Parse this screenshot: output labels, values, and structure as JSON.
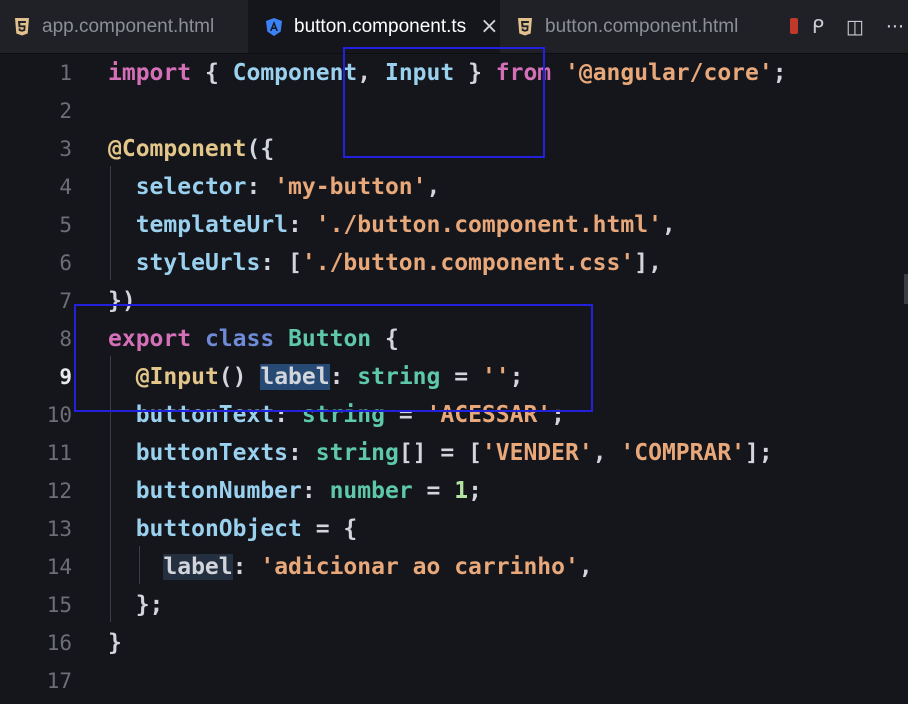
{
  "tabs": [
    {
      "label": "app.component.html",
      "icon": "html5-icon",
      "active": false
    },
    {
      "label": "button.component.ts",
      "icon": "angular-icon",
      "active": true,
      "close": "×"
    },
    {
      "label": "button.component.html",
      "icon": "html5-icon",
      "active": false
    }
  ],
  "toolbar": {
    "run": "ᑭ",
    "split": "◫",
    "more": "···"
  },
  "lines": [
    {
      "n": "1",
      "tokens": [
        [
          "kw",
          "import"
        ],
        [
          "pun",
          " { "
        ],
        [
          "prop",
          "Component"
        ],
        [
          "pun",
          ", "
        ],
        [
          "prop",
          "Input"
        ],
        [
          "pun",
          " } "
        ],
        [
          "kw",
          "from"
        ],
        [
          "pun",
          " "
        ],
        [
          "str",
          "'@angular/core'"
        ],
        [
          "pun",
          ";"
        ]
      ]
    },
    {
      "n": "2",
      "tokens": []
    },
    {
      "n": "3",
      "tokens": [
        [
          "dec",
          "@Component"
        ],
        [
          "pun",
          "({"
        ]
      ]
    },
    {
      "n": "4",
      "tokens": [
        [
          "pun",
          "  "
        ],
        [
          "prop",
          "selector"
        ],
        [
          "pun",
          ": "
        ],
        [
          "str",
          "'my-button'"
        ],
        [
          "pun",
          ","
        ]
      ]
    },
    {
      "n": "5",
      "tokens": [
        [
          "pun",
          "  "
        ],
        [
          "prop",
          "templateUrl"
        ],
        [
          "pun",
          ": "
        ],
        [
          "str",
          "'./button.component.html'"
        ],
        [
          "pun",
          ","
        ]
      ]
    },
    {
      "n": "6",
      "tokens": [
        [
          "pun",
          "  "
        ],
        [
          "prop",
          "styleUrls"
        ],
        [
          "pun",
          ": ["
        ],
        [
          "str",
          "'./button.component.css'"
        ],
        [
          "pun",
          "],"
        ]
      ]
    },
    {
      "n": "7",
      "tokens": [
        [
          "pun",
          "})"
        ]
      ]
    },
    {
      "n": "8",
      "tokens": [
        [
          "kw",
          "export"
        ],
        [
          "pun",
          " "
        ],
        [
          "kw2",
          "class"
        ],
        [
          "pun",
          " "
        ],
        [
          "cls",
          "Button"
        ],
        [
          "pun",
          " {"
        ]
      ]
    },
    {
      "n": "9",
      "tokens": [
        [
          "pun",
          "  "
        ],
        [
          "dec",
          "@Input"
        ],
        [
          "pun",
          "() "
        ],
        [
          "hl",
          "label"
        ],
        [
          "pun",
          ": "
        ],
        [
          "type",
          "string"
        ],
        [
          "pun",
          " = "
        ],
        [
          "str",
          "''"
        ],
        [
          "pun",
          ";"
        ]
      ]
    },
    {
      "n": "10",
      "tokens": [
        [
          "pun",
          "  "
        ],
        [
          "prop",
          "buttonText"
        ],
        [
          "pun",
          ": "
        ],
        [
          "type",
          "string"
        ],
        [
          "pun",
          " = "
        ],
        [
          "str",
          "'ACESSAR'"
        ],
        [
          "pun",
          ";"
        ]
      ]
    },
    {
      "n": "11",
      "tokens": [
        [
          "pun",
          "  "
        ],
        [
          "prop",
          "buttonTexts"
        ],
        [
          "pun",
          ": "
        ],
        [
          "type",
          "string"
        ],
        [
          "pun",
          "[] = ["
        ],
        [
          "str",
          "'VENDER'"
        ],
        [
          "pun",
          ", "
        ],
        [
          "str",
          "'COMPRAR'"
        ],
        [
          "pun",
          "];"
        ]
      ]
    },
    {
      "n": "12",
      "tokens": [
        [
          "pun",
          "  "
        ],
        [
          "prop",
          "buttonNumber"
        ],
        [
          "pun",
          ": "
        ],
        [
          "type",
          "number"
        ],
        [
          "pun",
          " = "
        ],
        [
          "num",
          "1"
        ],
        [
          "pun",
          ";"
        ]
      ]
    },
    {
      "n": "13",
      "tokens": [
        [
          "pun",
          "  "
        ],
        [
          "prop",
          "buttonObject"
        ],
        [
          "pun",
          " = {"
        ]
      ]
    },
    {
      "n": "14",
      "tokens": [
        [
          "pun",
          "    "
        ],
        [
          "hl2",
          "label"
        ],
        [
          "pun",
          ": "
        ],
        [
          "str",
          "'adicionar ao carrinho'"
        ],
        [
          "pun",
          ","
        ]
      ]
    },
    {
      "n": "15",
      "tokens": [
        [
          "pun",
          "  };"
        ]
      ]
    },
    {
      "n": "16",
      "tokens": [
        [
          "pun",
          "}"
        ]
      ]
    },
    {
      "n": "17",
      "tokens": []
    }
  ],
  "current_line": "9"
}
